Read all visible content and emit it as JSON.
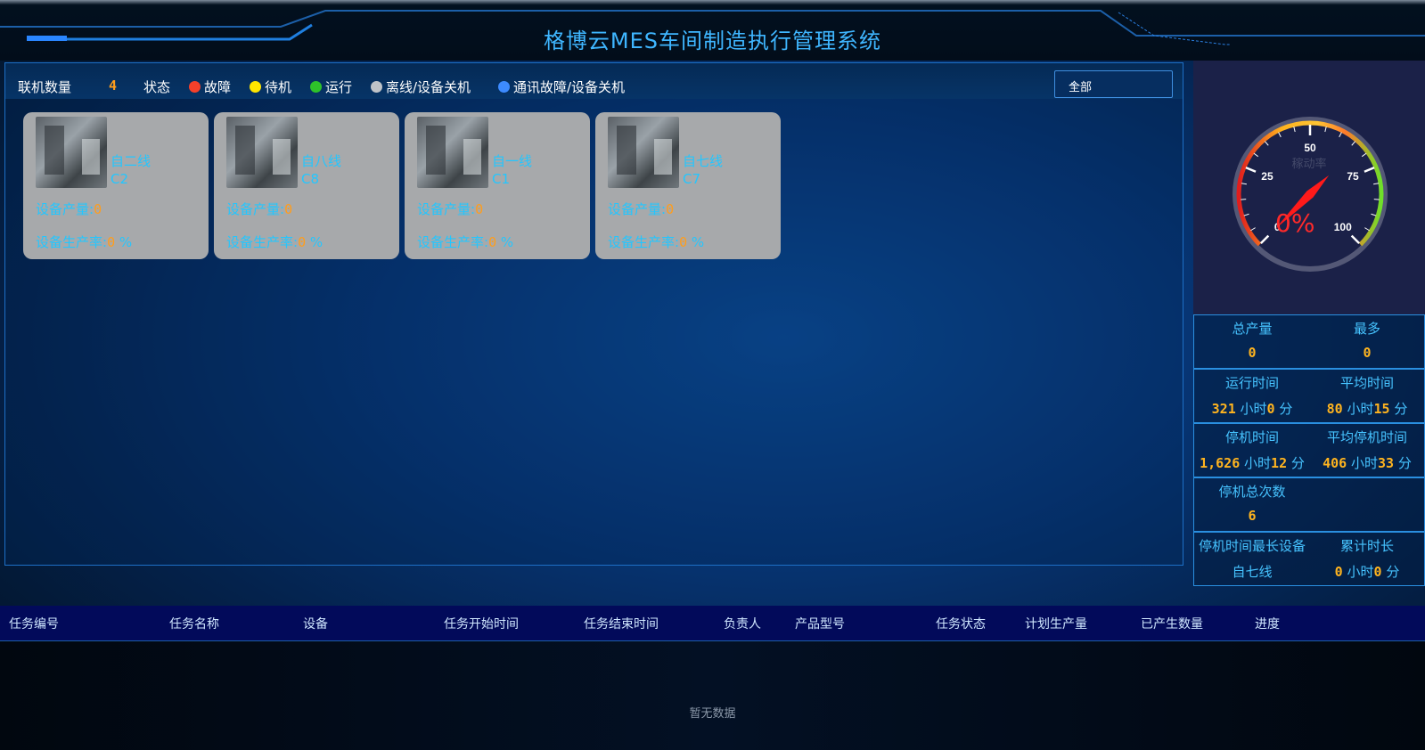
{
  "header": {
    "title": "格博云MES车间制造执行管理系统"
  },
  "status_bar": {
    "count_label": "联机数量",
    "count_value": "4",
    "state_label": "状态",
    "legend": [
      {
        "label": "故障",
        "color": "#f5402a"
      },
      {
        "label": "待机",
        "color": "#ffe600"
      },
      {
        "label": "运行",
        "color": "#2ec22a"
      },
      {
        "label": "离线/设备关机",
        "color": "#bfc3c8"
      },
      {
        "label": "通讯故障/设备关机",
        "color": "#3d8bff"
      }
    ],
    "filter": {
      "selected": "全部"
    }
  },
  "devices": [
    {
      "name": "自二线",
      "code": "C2",
      "output_label": "设备产量:",
      "output": "0",
      "rate_label": "设备生产率:",
      "rate": "0",
      "rate_unit": "%"
    },
    {
      "name": "自八线",
      "code": "C8",
      "output_label": "设备产量:",
      "output": "0",
      "rate_label": "设备生产率:",
      "rate": "0",
      "rate_unit": "%"
    },
    {
      "name": "自一线",
      "code": "C1",
      "output_label": "设备产量:",
      "output": "0",
      "rate_label": "设备生产率:",
      "rate": "0",
      "rate_unit": "%"
    },
    {
      "name": "自七线",
      "code": "C7",
      "output_label": "设备产量:",
      "output": "0",
      "rate_label": "设备生产率:",
      "rate": "0",
      "rate_unit": "%"
    }
  ],
  "gauge": {
    "label": "稼动率",
    "value_text": "0%",
    "value": 0,
    "ticks": [
      "0",
      "25",
      "50",
      "75",
      "100"
    ]
  },
  "stats": {
    "total_output": {
      "label": "总产量",
      "value": "0"
    },
    "most": {
      "label": "最多",
      "value": "0"
    },
    "run_time": {
      "label": "运行时间",
      "h": "321",
      "h_unit": "小时",
      "m": "0",
      "m_unit": "分"
    },
    "avg_time": {
      "label": "平均时间",
      "h": "80",
      "h_unit": "小时",
      "m": "15",
      "m_unit": "分"
    },
    "stop_time": {
      "label": "停机时间",
      "h": "1,626",
      "h_unit": "小时",
      "m": "12",
      "m_unit": "分"
    },
    "avg_stop_time": {
      "label": "平均停机时间",
      "h": "406",
      "h_unit": "小时",
      "m": "33",
      "m_unit": "分"
    },
    "stop_count": {
      "label": "停机总次数",
      "value": "6"
    },
    "longest_stop_device": {
      "label": "停机时间最长设备",
      "value": "自七线"
    },
    "cumulative": {
      "label": "累计时长",
      "h": "0",
      "h_unit": "小时",
      "m": "0",
      "m_unit": "分"
    }
  },
  "table": {
    "columns": [
      "任务编号",
      "任务名称",
      "设备",
      "任务开始时间",
      "任务结束时间",
      "负责人",
      "产品型号",
      "任务状态",
      "计划生产量",
      "已产生数量",
      "进度"
    ],
    "empty_text": "暂无数据"
  }
}
